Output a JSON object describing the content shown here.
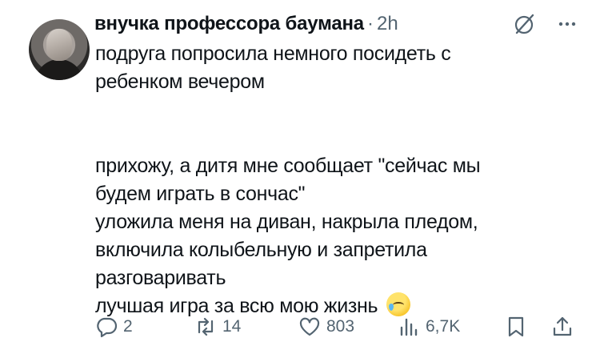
{
  "author": {
    "name": "внучка профессора баумана",
    "separator": "·",
    "time": "2h"
  },
  "tweet": {
    "lines_a": [
      "подруга попросила немного посидеть с",
      "ребенком вечером"
    ],
    "lines_b": [
      "прихожу, а дитя мне сообщает \"сейчас мы",
      "будем играть в сончас\"",
      "уложила меня на диван, накрыла пледом,",
      "включила колыбельную и запретила",
      "разговаривать",
      "лучшая игра за всю мою жизнь"
    ],
    "emoji": "face-holding-back-tears"
  },
  "actions": {
    "replies": "2",
    "reposts": "14",
    "likes": "803",
    "views": "6,7K"
  },
  "icons": [
    "grok-icon",
    "more-icon",
    "reply-icon",
    "repost-icon",
    "like-icon",
    "views-icon",
    "bookmark-icon",
    "share-icon"
  ],
  "colors": {
    "text": "#0f1419",
    "muted": "#536471",
    "background": "#ffffff"
  }
}
